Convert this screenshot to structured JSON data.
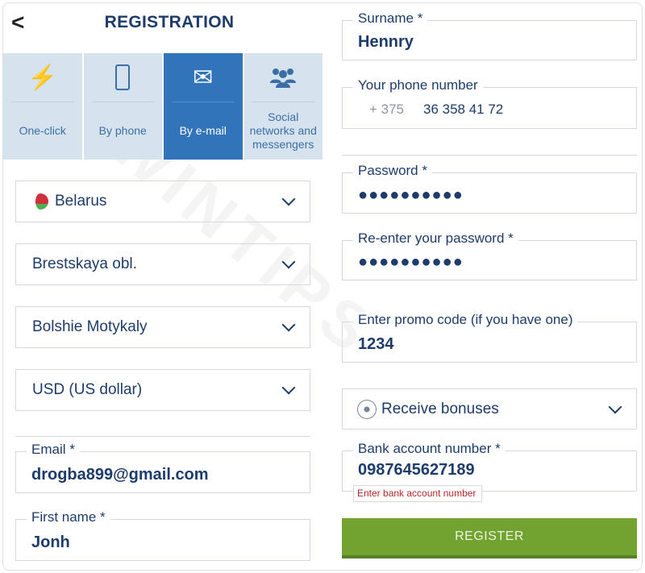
{
  "header": {
    "back": "<",
    "title": "REGISTRATION"
  },
  "tabs": [
    {
      "label": "One-click",
      "icon": "lightning-icon",
      "glyph": "⚡"
    },
    {
      "label": "By phone",
      "icon": "phone-icon",
      "glyph": "▯"
    },
    {
      "label": "By e-mail",
      "icon": "envelope-icon",
      "glyph": "✉",
      "active": true
    },
    {
      "label": "Social networks and messengers",
      "icon": "users-icon",
      "glyph": "👥"
    }
  ],
  "left": {
    "country": "Belarus",
    "region": "Brestskaya obl.",
    "city": "Bolshie Motykaly",
    "currency": "USD (US dollar)",
    "email": {
      "label": "Email  *",
      "value": "drogba899@gmail.com"
    },
    "first_name": {
      "label": "First name  *",
      "value": "Jonh"
    }
  },
  "right": {
    "surname": {
      "label": "Surname  *",
      "value": "Hennry"
    },
    "phone": {
      "label": "Your phone number",
      "code": "+ 375",
      "value": "36 358 41 72"
    },
    "password": {
      "label": "Password  *",
      "value": "●●●●●●●●●●"
    },
    "repassword": {
      "label": "Re-enter your password  *",
      "value": "●●●●●●●●●●"
    },
    "promo": {
      "label": "Enter promo code (if you have one)",
      "value": "1234"
    },
    "bonus": "Receive bonuses",
    "bank": {
      "label": "Bank account number  *",
      "value": "0987645627189",
      "error": "Enter bank account number"
    },
    "register": "REGISTER"
  },
  "colors": {
    "primary": "#1d3c6b",
    "tab_active": "#3274b9",
    "tab_bg": "#d6e3ef",
    "register": "#72a22f",
    "error": "#b3262b"
  },
  "watermark": "WINTIPS"
}
